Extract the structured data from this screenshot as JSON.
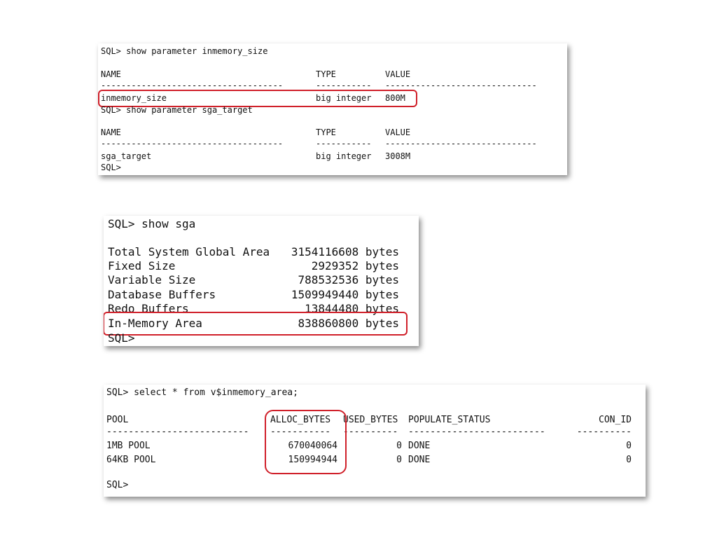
{
  "panel1": {
    "cmd1": "SQL> show parameter inmemory_size",
    "header": {
      "name": "NAME",
      "type": "TYPE",
      "value": "VALUE"
    },
    "sep": {
      "name": "------------------------------------",
      "type": "-----------",
      "value": "------------------------------"
    },
    "row1": {
      "name": "inmemory_size",
      "type": "big integer",
      "value": "800M"
    },
    "cmd2": "SQL> show parameter sga_target",
    "header2": {
      "name": "NAME",
      "type": "TYPE",
      "value": "VALUE"
    },
    "sep2": {
      "name": "------------------------------------",
      "type": "-----------",
      "value": "------------------------------"
    },
    "row2": {
      "name": "sga_target",
      "type": "big integer",
      "value": "3008M"
    },
    "prompt": "SQL>"
  },
  "panel2": {
    "cmd": "SQL> show sga",
    "rows": [
      {
        "label": "Total System Global Area",
        "value": "3154116608 bytes"
      },
      {
        "label": "Fixed Size",
        "value": "2929352 bytes"
      },
      {
        "label": "Variable Size",
        "value": "788532536 bytes"
      },
      {
        "label": "Database Buffers",
        "value": "1509949440 bytes"
      },
      {
        "label": "Redo Buffers",
        "value": "13844480 bytes"
      },
      {
        "label": "In-Memory Area",
        "value": "838860800 bytes"
      }
    ],
    "prompt": "SQL>"
  },
  "panel3": {
    "cmd": "SQL> select * from v$inmemory_area;",
    "headers": {
      "pool": "POOL",
      "alloc": "ALLOC_BYTES",
      "used": "USED_BYTES",
      "status": "POPULATE_STATUS",
      "con": "CON_ID"
    },
    "seps": {
      "pool": "--------------------------",
      "alloc": "-----------",
      "used": "----------",
      "status": "-------------------------",
      "con": "----------"
    },
    "rows": [
      {
        "pool": "1MB POOL",
        "alloc": "670040064",
        "used": "0",
        "status": "DONE",
        "con": "0"
      },
      {
        "pool": "64KB POOL",
        "alloc": "150994944",
        "used": "0",
        "status": "DONE",
        "con": "0"
      }
    ],
    "prompt": "SQL>"
  }
}
